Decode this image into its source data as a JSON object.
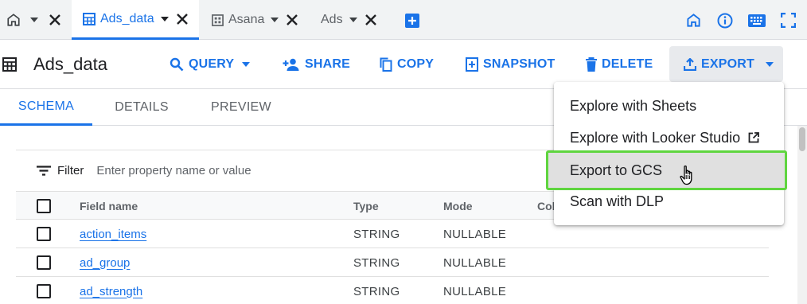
{
  "tabs": [
    {
      "label": "",
      "icon": "home-icon",
      "active": false
    },
    {
      "label": "Ads_data",
      "icon": "table-icon",
      "active": true
    },
    {
      "label": "Asana",
      "icon": "dataset-icon",
      "active": false
    },
    {
      "label": "Ads",
      "icon": "",
      "active": false
    }
  ],
  "header_icons": [
    "add-tab-icon",
    "home-icon",
    "info-icon",
    "keyboard-icon",
    "fullscreen-icon"
  ],
  "toolbar": {
    "title": "Ads_data",
    "query_label": "QUERY",
    "share_label": "SHARE",
    "copy_label": "COPY",
    "snapshot_label": "SNAPSHOT",
    "delete_label": "DELETE",
    "export_label": "EXPORT"
  },
  "subtabs": [
    {
      "label": "SCHEMA",
      "active": true
    },
    {
      "label": "DETAILS",
      "active": false
    },
    {
      "label": "PREVIEW",
      "active": false
    }
  ],
  "filter": {
    "label": "Filter",
    "placeholder": "Enter property name or value"
  },
  "table": {
    "headers": {
      "field": "Field name",
      "type": "Type",
      "mode": "Mode",
      "col": "Col"
    },
    "rows": [
      {
        "field": "action_items",
        "type": "STRING",
        "mode": "NULLABLE"
      },
      {
        "field": "ad_group",
        "type": "STRING",
        "mode": "NULLABLE"
      },
      {
        "field": "ad_strength",
        "type": "STRING",
        "mode": "NULLABLE"
      }
    ]
  },
  "export_menu": {
    "items": [
      {
        "label": "Explore with Sheets",
        "highlighted": false
      },
      {
        "label": "Explore with Looker Studio",
        "highlighted": false,
        "icon": "open-in-new-icon"
      },
      {
        "label": "Export to GCS",
        "highlighted": true
      },
      {
        "label": "Scan with DLP",
        "highlighted": false
      }
    ]
  },
  "colors": {
    "accent": "#1a73e8",
    "highlight_border": "#5fd53f",
    "tabstrip_bg": "#f1f3f4"
  }
}
